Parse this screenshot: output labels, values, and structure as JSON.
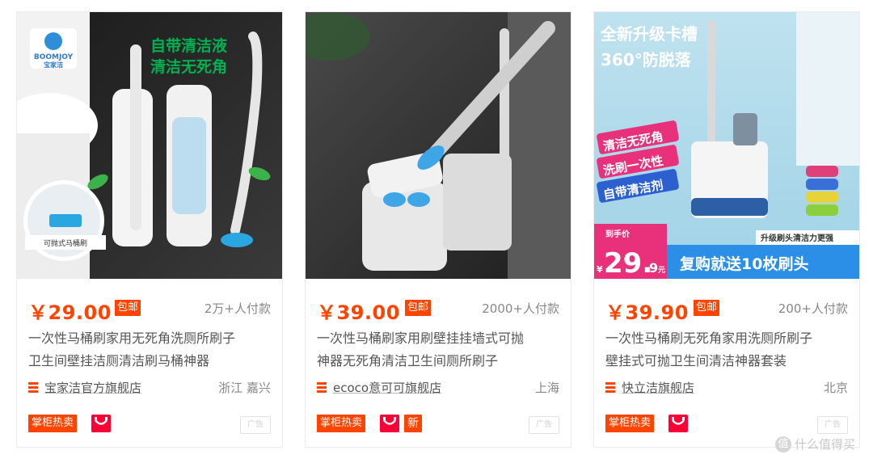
{
  "products": [
    {
      "price": "￥29.00",
      "baoyou": "包邮",
      "sales": "2万+人付款",
      "title_line1": "一次性马桶刷家用无死角洗厕所刷子",
      "title_line2": "卫生间壁挂洁厕清洁刷马桶神器",
      "shop": "宝家洁官方旗舰店",
      "location": "浙江 嘉兴",
      "hot_badge": "掌柜热卖",
      "ad_label": "广告",
      "image": {
        "logo_text": "BOOMJOY",
        "logo_sub": "宝家洁",
        "headline1": "自带清洁液",
        "headline2": "清洁无死角",
        "inset_caption": "可抛式马桶刷"
      }
    },
    {
      "price": "￥39.00",
      "baoyou": "包邮",
      "sales": "2000+人付款",
      "title_line1": "一次性马桶刷家用刷壁挂挂墙式可抛",
      "title_line2": "神器无死角清洁卫生间厕所刷子",
      "shop": "ecoco意可可旗舰店",
      "location": "上海",
      "hot_badge": "掌柜热卖",
      "new_badge": "新",
      "ad_label": "广告"
    },
    {
      "price": "￥39.90",
      "baoyou": "包邮",
      "sales": "200+人付款",
      "title_line1": "一次性马桶刷无死角家用洗厕所刷子",
      "title_line2": "壁挂式可抛卫生间清洁神器套装",
      "shop": "快立洁旗舰店",
      "location": "北京",
      "hot_badge": "掌柜热卖",
      "ad_label": "广告",
      "image": {
        "headline1": "全新升级卡槽",
        "headline2": "360°防脱落",
        "tag1": "清洁无死角",
        "tag2": "洗刷一次性",
        "tag3": "自带清洁剂",
        "upgrade_note": "升级刷头清洁力更强",
        "deal_label": "到手价",
        "deal_price": "29.",
        "deal_cents": "9",
        "deal_unit": "元",
        "currency": "¥",
        "gift": "复购就送10枚刷头"
      }
    }
  ],
  "watermark": {
    "icon": "值",
    "text": "什么值得买"
  },
  "colors": {
    "accent": "#ff4400",
    "tmall": "#ff0036"
  }
}
